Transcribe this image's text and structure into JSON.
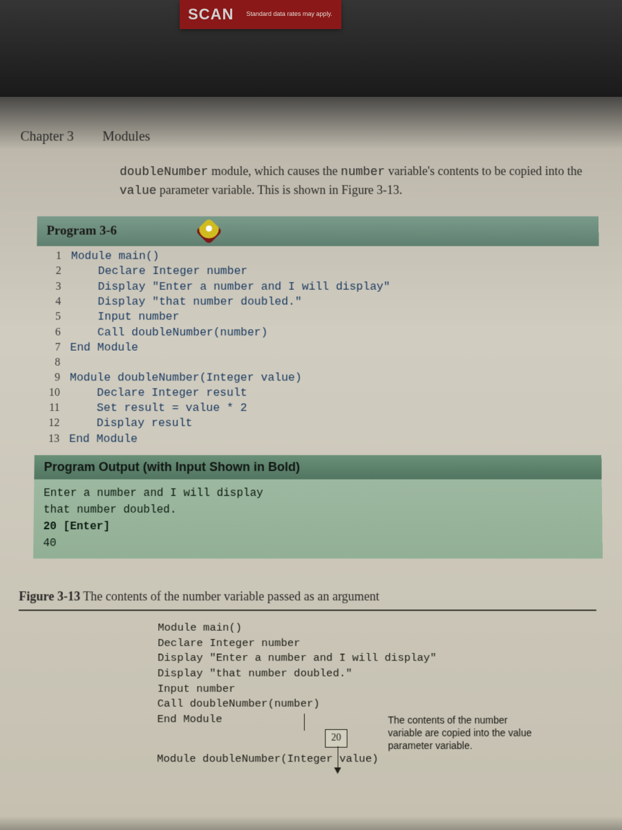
{
  "scan": {
    "title": "SCAN",
    "sub": "Standard data rates may apply."
  },
  "chapter": {
    "num": "Chapter 3",
    "title": "Modules"
  },
  "paragraph": {
    "pre": "doubleNumber",
    "mid1": " module, which causes the ",
    "kw2": "number",
    "mid2": " variable's contents to be copied into the ",
    "kw3": "value",
    "mid3": " parameter variable. This is shown in Figure 3-13."
  },
  "program_header": "Program 3-6",
  "code": [
    "Module main()",
    "    Declare Integer number",
    "    Display \"Enter a number and I will display\"",
    "    Display \"that number doubled.\"",
    "    Input number",
    "    Call doubleNumber(number)",
    "End Module",
    "",
    "Module doubleNumber(Integer value)",
    "    Declare Integer result",
    "    Set result = value * 2",
    "    Display result",
    "End Module"
  ],
  "line_numbers": [
    "1",
    "2",
    "3",
    "4",
    "5",
    "6",
    "7",
    "8",
    "9",
    "10",
    "11",
    "12",
    "13"
  ],
  "output_header": "Program Output (with Input Shown in Bold)",
  "output": {
    "l1": "Enter a number and I will display",
    "l2": "that number doubled.",
    "input": "20",
    "enter": " [Enter]",
    "l4": "40"
  },
  "figure": {
    "num": "Figure 3-13",
    "caption": " The contents of the number variable passed as an argument"
  },
  "figure_code": [
    "Module main()",
    "   Declare Integer number",
    "   Display \"Enter a number and I will display\"",
    "   Display \"that number doubled.\"",
    "   Input number",
    "   Call doubleNumber(number)",
    "End Module",
    "",
    "Module doubleNumber(Integer value)"
  ],
  "figure_box": "20",
  "annotation": "The contents of the number variable are copied into the value parameter variable.",
  "figure_bottom_prefix": "Module"
}
